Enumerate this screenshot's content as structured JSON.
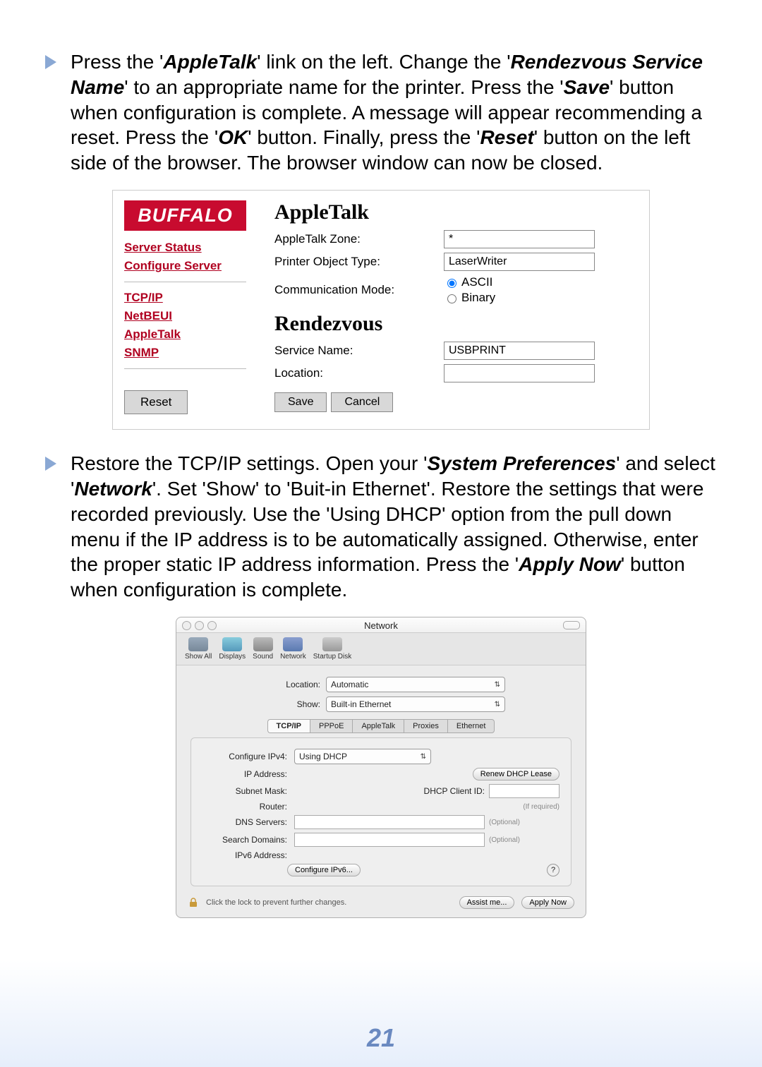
{
  "instructions": {
    "p1_parts": [
      "Press the '",
      "AppleTalk",
      "' link on the left. Change the '",
      "Rendezvous Service Name",
      "' to an appropriate name for the printer. Press the '",
      "Save",
      "' button when configuration is complete. A message will appear recommending a reset. Press the '",
      "OK",
      "' button. Finally, press the '",
      "Reset",
      "' button on the left side of the browser. The browser window can now be closed."
    ],
    "p2_parts": [
      "Restore the TCP/IP settings. Open your '",
      "System Preferences",
      "' and select '",
      "Network",
      "'. Set 'Show' to 'Buit-in Ethernet'. Restore the settings that were recorded previously. Use the 'Using DHCP' option from the pull down menu if the IP address is to be automatically assigned. Otherwise, enter the proper static IP address information. Press the '",
      "Apply Now",
      "' button when configuration is complete."
    ]
  },
  "buffalo": {
    "logo": "BUFFALO",
    "sidebar": {
      "main": [
        "Server Status",
        "Configure Server"
      ],
      "protocols": [
        "TCP/IP",
        "NetBEUI",
        "AppleTalk",
        "SNMP"
      ],
      "reset_label": "Reset"
    },
    "apple": {
      "heading": "AppleTalk",
      "zone_lbl": "AppleTalk Zone:",
      "zone_val": "*",
      "pot_lbl": "Printer Object Type:",
      "pot_val": "LaserWriter",
      "comm_lbl": "Communication Mode:",
      "comm_ascii": "ASCII",
      "comm_binary": "Binary"
    },
    "rendezvous": {
      "heading": "Rendezvous",
      "svc_lbl": "Service Name:",
      "svc_val": "USBPRINT",
      "loc_lbl": "Location:",
      "loc_val": ""
    },
    "buttons": {
      "save": "Save",
      "cancel": "Cancel"
    }
  },
  "mac": {
    "title": "Network",
    "toolbar": [
      "Show All",
      "Displays",
      "Sound",
      "Network",
      "Startup Disk"
    ],
    "location_lbl": "Location:",
    "location_val": "Automatic",
    "show_lbl": "Show:",
    "show_val": "Built-in Ethernet",
    "tabs": [
      "TCP/IP",
      "PPPoE",
      "AppleTalk",
      "Proxies",
      "Ethernet"
    ],
    "active_tab": "TCP/IP",
    "fields": {
      "config_lbl": "Configure IPv4:",
      "config_val": "Using DHCP",
      "ip_lbl": "IP Address:",
      "renew_btn": "Renew DHCP Lease",
      "subnet_lbl": "Subnet Mask:",
      "dhcp_client_lbl": "DHCP Client ID:",
      "dhcp_client_note": "(If required)",
      "router_lbl": "Router:",
      "dns_lbl": "DNS Servers:",
      "dns_note": "(Optional)",
      "search_lbl": "Search Domains:",
      "search_note": "(Optional)",
      "ipv6addr_lbl": "IPv6 Address:",
      "ipv6_btn": "Configure IPv6..."
    },
    "footer": {
      "lock_text": "Click the lock to prevent further changes.",
      "assist": "Assist me...",
      "apply": "Apply Now"
    }
  },
  "page_number": "21"
}
